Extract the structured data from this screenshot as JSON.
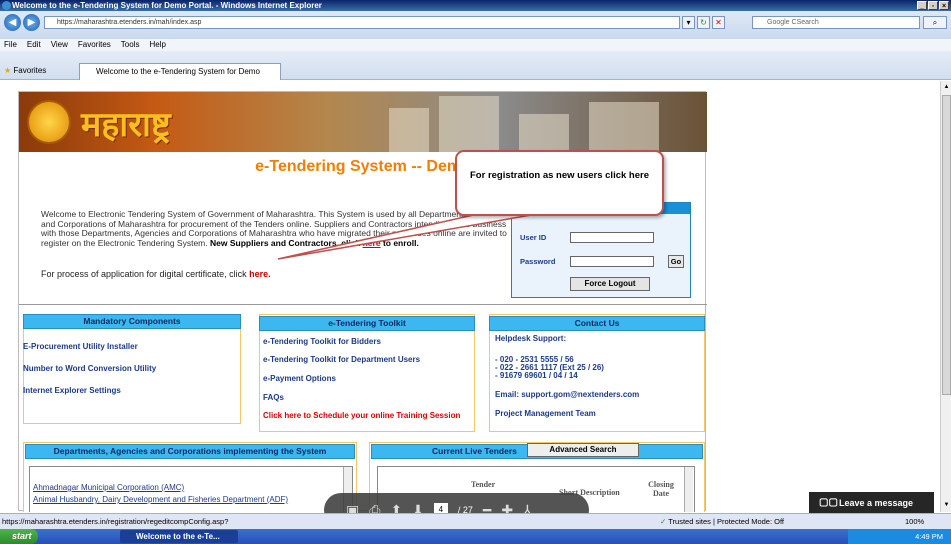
{
  "window": {
    "title": "Welcome to the e-Tendering System for Demo Portal. - Windows Internet Explorer"
  },
  "address": {
    "url": "https://maharashtra.etenders.in/mah/index.asp",
    "search_placeholder": "Google CSearch"
  },
  "menu": [
    "File",
    "Edit",
    "View",
    "Favorites",
    "Tools",
    "Help"
  ],
  "favorites_label": "Favorites",
  "tab_title": "Welcome to the e-Tendering System for Demo Portal.",
  "banner_text": "महाराष्ट्र",
  "system_title": "e-Tendering System -- Demo",
  "welcome": {
    "text": "Welcome to Electronic Tendering System of Government of Maharashtra. This System is used by all Departments, Agencies and Corporations of Maharashtra for procurement of the Tenders online. Suppliers and Contractors intending to do business with those Departments, Agencies and Corporations of Maharashtra who have migrated their processes online are invited to register on the Electronic Tendering System.",
    "bold": "New Suppliers and Contractors, click",
    "link": "here",
    "after": "to enroll."
  },
  "cert": {
    "text": "For process of application for digital certificate, click",
    "link": "here."
  },
  "login": {
    "user_label": "User ID",
    "password_label": "Password",
    "go": "Go",
    "force_logout": "Force Logout"
  },
  "mandatory": {
    "header": "Mandatory Components",
    "links": [
      "E-Procurement Utility Installer",
      "Number to Word Conversion Utility",
      "Internet Explorer Settings"
    ]
  },
  "toolkit": {
    "header": "e-Tendering Toolkit",
    "links": [
      "e-Tendering Toolkit for Bidders",
      "e-Tendering Toolkit for Department Users",
      "e-Payment Options",
      "FAQs"
    ],
    "training": "Click here to Schedule your online Training Session"
  },
  "contact": {
    "header": "Contact Us",
    "helpdesk": "Helpdesk Support:",
    "phones": [
      "- 020 - 2531 5555 / 56",
      "- 022 - 2661 1117 (Ext 25 / 26)",
      "- 91679 69601 / 04 / 14"
    ],
    "email": "Email: support.gom@nextenders.com",
    "pmt": "Project Management Team"
  },
  "departments": {
    "header": "Departments, Agencies and Corporations implementing the System",
    "items": [
      "Ahmadnagar Municipal Corporation (AMC)",
      "Animal Husbandry, Dairy Development and Fisheries Department (ADF)"
    ]
  },
  "tenders": {
    "header": "Current Live Tenders",
    "advanced": "Advanced Search",
    "col_tender": "Tender",
    "col_desc": "Short Description",
    "col_closing": "Closing Date"
  },
  "callout": "For registration as new users click here",
  "pdf": {
    "page": "4",
    "of": "/ 27"
  },
  "leave_message": "Leave a message",
  "status": {
    "url": "https://maharashtra.etenders.in/registration/regeditcompConfig.asp?",
    "zone": "Trusted sites | Protected Mode: Off",
    "zoom": "100%"
  },
  "taskbar": {
    "start": "start",
    "task": "Welcome to the e-Te...",
    "time": "4:49 PM"
  }
}
